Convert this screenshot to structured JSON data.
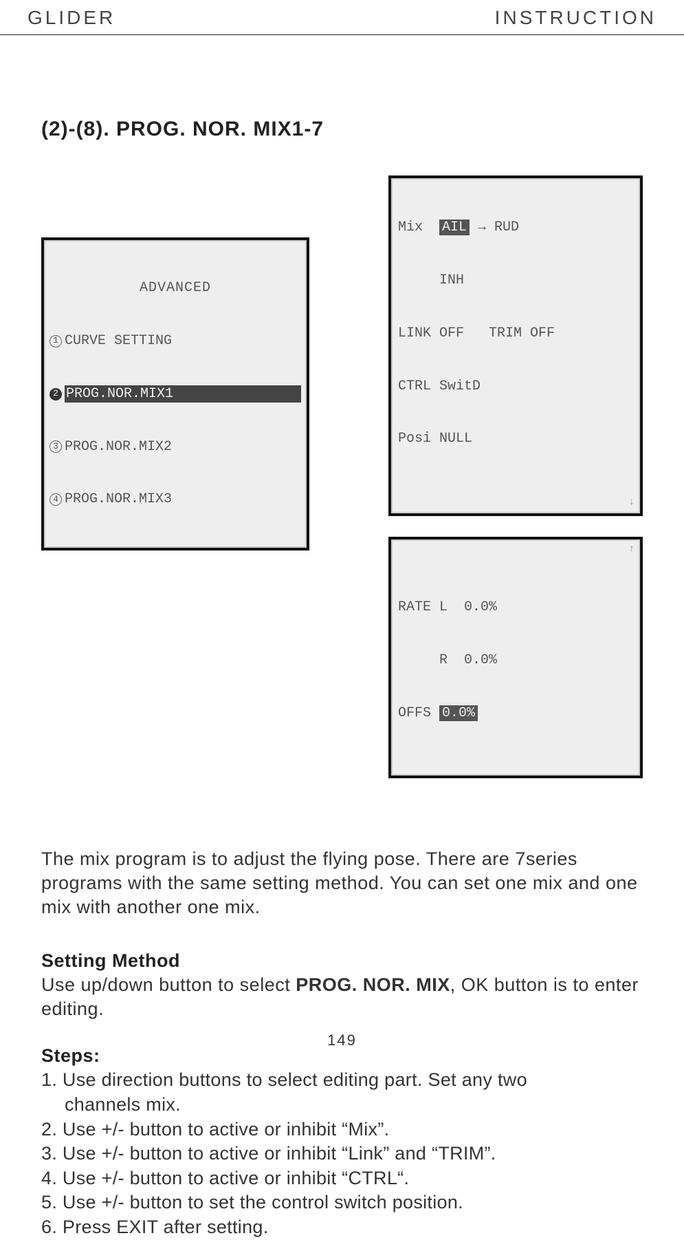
{
  "header": {
    "left": "GLIDER",
    "right": "INSTRUCTION"
  },
  "section_title": "(2)-(8). PROG. NOR. MIX1-7",
  "lcd_menu": {
    "title": "ADVANCED",
    "rows": [
      {
        "num": "1",
        "label": "CURVE SETTING"
      },
      {
        "num": "2",
        "label": "PROG.NOR.MIX1",
        "selected": true
      },
      {
        "num": "3",
        "label": "PROG.NOR.MIX2"
      },
      {
        "num": "4",
        "label": "PROG.NOR.MIX3"
      }
    ]
  },
  "lcd_mix": {
    "line1_pre": "Mix  ",
    "line1_hl": "AIL",
    "line1_post": " → RUD",
    "line2": "     INH",
    "line3": "LINK OFF   TRIM OFF",
    "line4": "CTRL SwitD",
    "line5": "Posi NULL"
  },
  "lcd_rate": {
    "line1": "RATE L  0.0%",
    "line2": "     R  0.0%",
    "line3_pre": "OFFS ",
    "line3_hl": "0.0%"
  },
  "intro_para": "The mix program is to adjust the flying pose. There are 7series programs with the same setting method. You can set one mix and one mix with another one mix.",
  "setting_method": {
    "title": "Setting Method",
    "body_pre": "Use up/down button to select ",
    "body_bold": "PROG. NOR. MIX",
    "body_post": ", OK button is to enter editing."
  },
  "steps_title": "Steps:",
  "steps": [
    "1. Use direction buttons to select editing part. Set any two",
    "    channels mix.",
    "2. Use +/- button to active or inhibit “Mix”.",
    "3. Use +/- button to active or inhibit “Link” and “TRIM”.",
    "4. Use +/- button to active or inhibit  “CTRL“.",
    "5. Use +/- button to set the control switch position.",
    "6. Press EXIT after setting."
  ],
  "page_number": "149"
}
